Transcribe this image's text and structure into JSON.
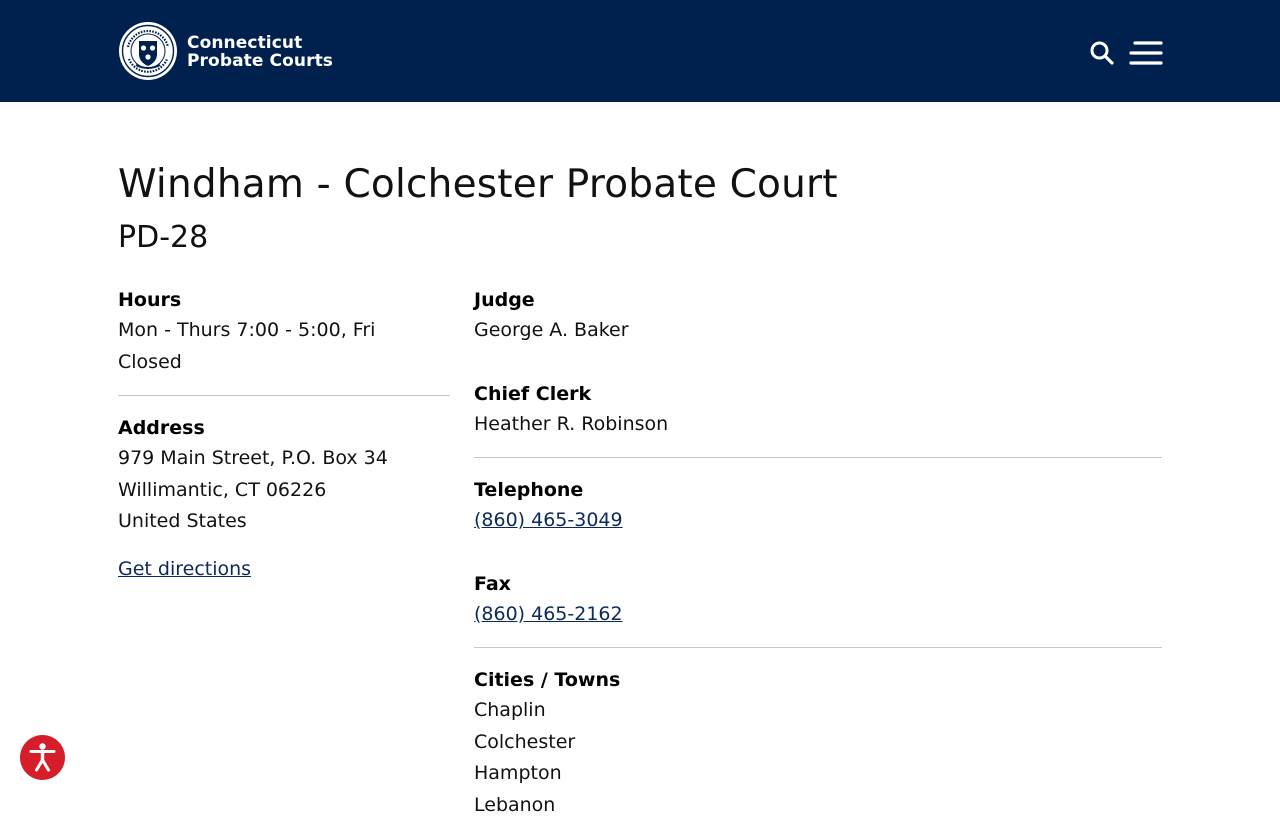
{
  "header": {
    "brand_line1": "Connecticut",
    "brand_line2": "Probate Courts",
    "logo_text": "CONNECTICUT PROBATE COURTS"
  },
  "page": {
    "title": "Windham - Colchester Probate Court",
    "subtitle": "PD-28"
  },
  "hours": {
    "label": "Hours",
    "line1": "Mon - Thurs 7:00 - 5:00, Fri",
    "line2": "Closed"
  },
  "address": {
    "label": "Address",
    "line1": "979 Main Street, P.O. Box 34",
    "line2": "Willimantic, CT 06226",
    "line3": "United States",
    "directions_link": "Get directions"
  },
  "judge": {
    "label": "Judge",
    "name": "George A. Baker"
  },
  "chief_clerk": {
    "label": "Chief Clerk",
    "name": "Heather R. Robinson"
  },
  "telephone": {
    "label": "Telephone",
    "number": "(860) 465-3049"
  },
  "fax": {
    "label": "Fax",
    "number": "(860) 465-2162"
  },
  "towns": {
    "label": "Cities / Towns",
    "items": [
      "Chaplin",
      "Colchester",
      "Hampton",
      "Lebanon"
    ]
  },
  "colors": {
    "header_bg": "#00204e",
    "link": "#0b2a5a",
    "accessibility_button": "#d51e2a"
  },
  "icons": {
    "search": "search-icon",
    "menu": "hamburger-menu-icon",
    "accessibility": "accessibility-icon",
    "logo": "state-seal-icon"
  }
}
